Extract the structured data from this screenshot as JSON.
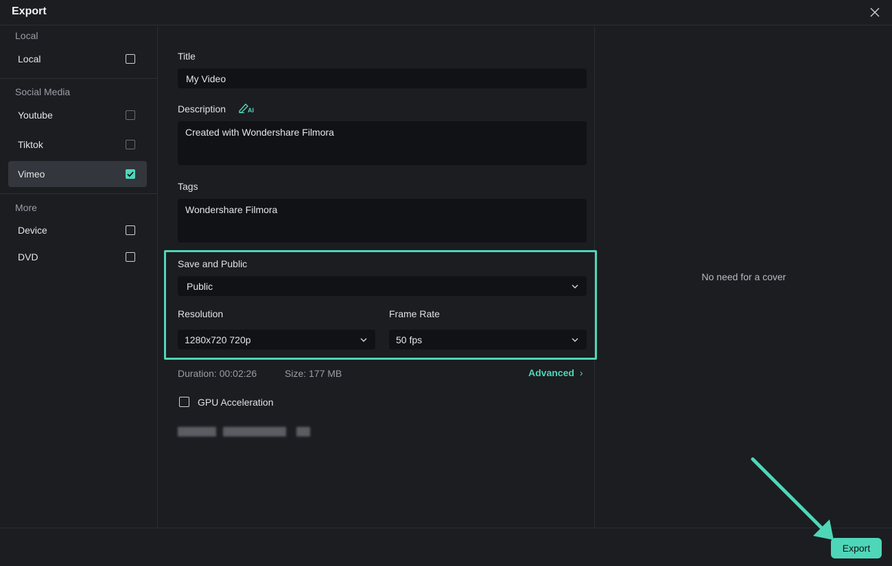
{
  "window": {
    "title": "Export"
  },
  "sidebar": {
    "sections": {
      "local": "Local",
      "social": "Social Media",
      "more": "More"
    },
    "items": [
      {
        "label": "Local",
        "checked": false
      },
      {
        "label": "Youtube",
        "checked": false
      },
      {
        "label": "Tiktok",
        "checked": false
      },
      {
        "label": "Vimeo",
        "checked": true
      },
      {
        "label": "Device",
        "checked": false
      },
      {
        "label": "DVD",
        "checked": false
      }
    ]
  },
  "form": {
    "title_label": "Title",
    "title_value": "My Video",
    "description_label": "Description",
    "description_value": "Created with Wondershare Filmora",
    "tags_label": "Tags",
    "tags_value": "Wondershare Filmora",
    "save_public_label": "Save and Public",
    "save_public_value": "Public",
    "resolution_label": "Resolution",
    "resolution_value": "1280x720 720p",
    "frame_rate_label": "Frame Rate",
    "frame_rate_value": "50 fps",
    "duration": "Duration: 00:02:26",
    "size": "Size:  177 MB",
    "advanced_label": "Advanced",
    "gpu_label": "GPU Acceleration",
    "gpu_checked": false
  },
  "preview": {
    "cover_text": "No need for a cover"
  },
  "footer": {
    "export_label": "Export"
  },
  "colors": {
    "accent": "#4fd6b8",
    "background": "#1b1d21",
    "field": "#101215"
  }
}
